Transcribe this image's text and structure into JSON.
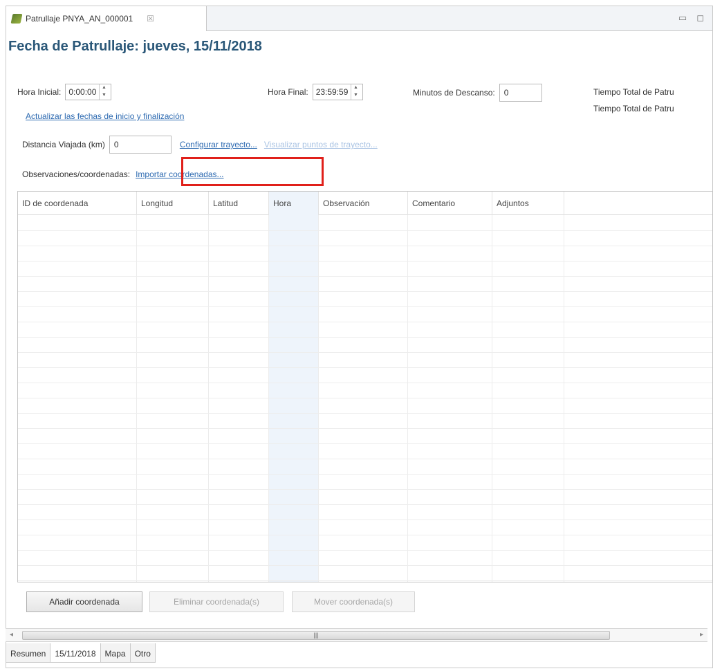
{
  "tab": {
    "title": "Patrullaje PNYA_AN_000001",
    "close": "☒"
  },
  "window": {
    "minimize": "▭",
    "maximize": "◻"
  },
  "page_title": "Fecha de Patrullaje:  jueves, 15/11/2018",
  "hora_inicial": {
    "label": "Hora Inicial:",
    "value": "0:00:00"
  },
  "hora_final": {
    "label": "Hora Final:",
    "value": "23:59:59"
  },
  "minutos_descanso": {
    "label": "Minutos de Descanso:",
    "value": "0"
  },
  "tiempo_total_1": "Tiempo Total de Patru",
  "tiempo_total_2": "Tiempo Total de Patru",
  "link_actualizar": "Actualizar las fechas de inicio y finalización",
  "distancia": {
    "label": "Distancia Viajada (km)",
    "value": "0"
  },
  "link_configurar": "Configurar trayecto...",
  "link_visualizar": "Visualizar puntos de trayecto...",
  "observaciones_label": "Observaciones/coordenadas:",
  "link_importar": "Importar coordenadas...",
  "columns": [
    "ID de coordenada",
    "Longitud",
    "Latitud",
    "Hora",
    "Observación",
    "Comentario",
    "Adjuntos"
  ],
  "buttons": {
    "add": "Añadir coordenada",
    "delete": "Eliminar coordenada(s)",
    "move": "Mover coordenada(s)"
  },
  "scrollbar": {
    "left": "◂",
    "right": "▸",
    "grip": "|||"
  },
  "bottom_tabs": [
    "Resumen",
    "15/11/2018",
    "Mapa",
    "Otro"
  ],
  "active_bottom_tab": "15/11/2018"
}
